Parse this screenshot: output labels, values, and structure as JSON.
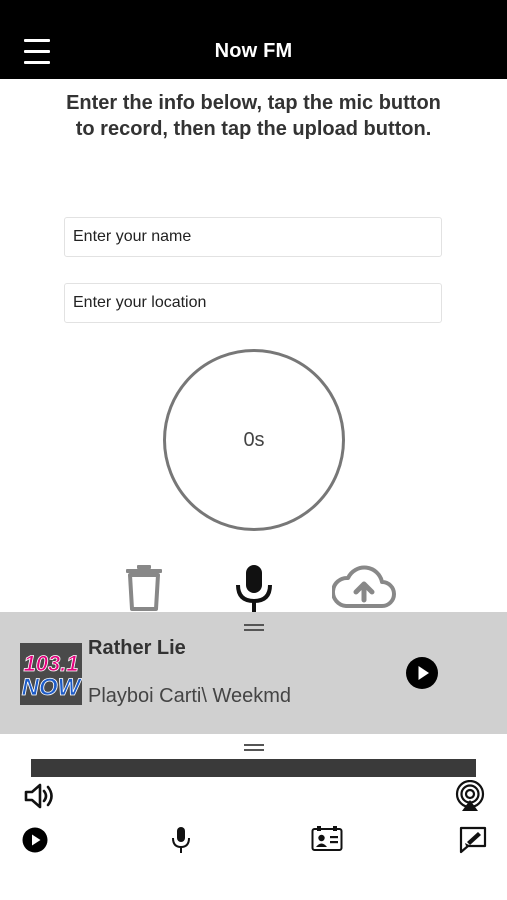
{
  "header": {
    "title": "Now FM",
    "menu_icon": "hamburger-menu-icon"
  },
  "instructions": "Enter the info below, tap the mic button to record, then tap the upload button.",
  "form": {
    "name_placeholder": "Enter your name",
    "location_placeholder": "Enter your location"
  },
  "timer": {
    "label": "0s"
  },
  "actions": {
    "delete_icon": "trash-icon",
    "record_icon": "microphone-icon",
    "upload_icon": "cloud-upload-icon"
  },
  "now_playing": {
    "station_logo_text": "103.1 NOW",
    "title": "Rather Lie",
    "artist": "Playboi Carti\\ Weekmd",
    "play_icon": "play-icon"
  },
  "player": {
    "progress": 0,
    "volume_icon": "volume-icon",
    "airplay_icon": "airplay-icon"
  },
  "tabbar": {
    "items": [
      {
        "icon": "play-circle-icon"
      },
      {
        "icon": "microphone-icon"
      },
      {
        "icon": "contact-card-icon"
      },
      {
        "icon": "compose-icon"
      }
    ]
  },
  "colors": {
    "header_bg": "#000000",
    "now_playing_bg": "#d0d0d0",
    "progress_bar": "#3a3a3a",
    "logo_pink": "#e5007e",
    "logo_blue": "#1e5cc8"
  }
}
